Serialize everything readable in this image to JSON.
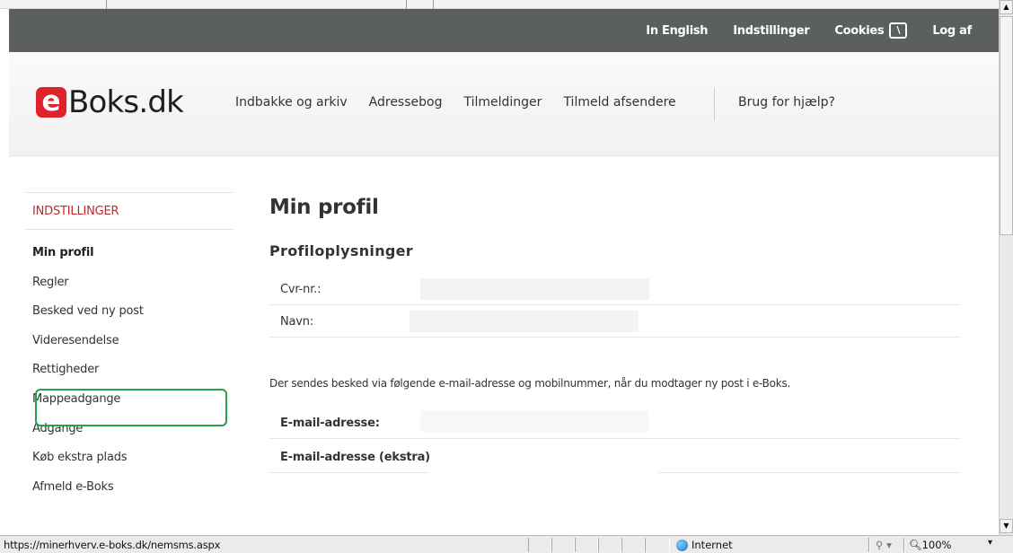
{
  "topbar": {
    "links": [
      {
        "label": "In English"
      },
      {
        "label": "Indstillinger"
      },
      {
        "label": "Cookies"
      },
      {
        "label": "Log af"
      }
    ]
  },
  "header": {
    "logo_letter": "e",
    "logo_text": "Boks.dk",
    "nav": [
      "Indbakke og arkiv",
      "Adressebog",
      "Tilmeldinger",
      "Tilmeld afsendere"
    ],
    "help": "Brug for hjælp?"
  },
  "sidebar": {
    "heading": "INDSTILLINGER",
    "items": [
      {
        "label": "Min profil"
      },
      {
        "label": "Regler"
      },
      {
        "label": "Besked ved ny post"
      },
      {
        "label": "Videresendelse"
      },
      {
        "label": "Rettigheder"
      },
      {
        "label": "Mappeadgange"
      },
      {
        "label": "Adgange"
      },
      {
        "label": "Køb ekstra plads"
      },
      {
        "label": "Afmeld e-Boks"
      }
    ]
  },
  "main": {
    "title": "Min profil",
    "section_title": "Profiloplysninger",
    "fields": [
      {
        "label": "Cvr-nr.:",
        "value": ""
      },
      {
        "label": "Navn:",
        "value": ""
      }
    ],
    "notice": "Der sendes besked via følgende e-mail-adresse og mobilnummer, når du modtager ny post i e-Boks.",
    "contact_fields": [
      {
        "label": "E-mail-adresse:",
        "value": ""
      },
      {
        "label": "E-mail-adresse (ekstra):",
        "value": ""
      }
    ]
  },
  "statusbar": {
    "url": "https://minerhverv.e-boks.dk/nemsms.aspx",
    "zone": "Internet",
    "zoom": "100%"
  },
  "colors": {
    "brand_red": "#e0222b",
    "topbar": "#5c5f5f",
    "highlight_green": "#22a24a"
  },
  "icons": {
    "cookie": "cookie-icon",
    "zone": "globe-icon",
    "zoom": "magnifier-icon"
  }
}
